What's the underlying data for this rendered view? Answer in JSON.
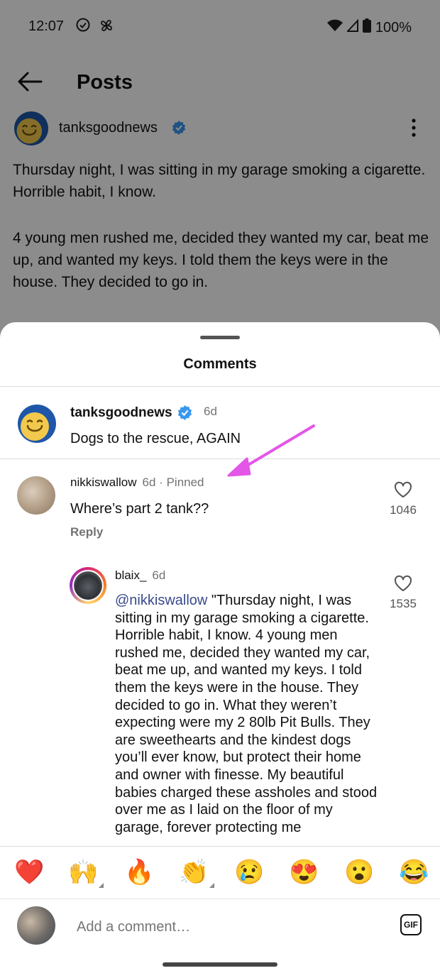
{
  "status_bar": {
    "time": "12:07",
    "battery": "100%"
  },
  "header": {
    "title": "Posts"
  },
  "post": {
    "author": "tanksgoodnews",
    "paragraphs": [
      "Thursday night, I was sitting in my garage smoking a cigarette. Horrible habit, I know.",
      "4 young men rushed me, decided they wanted my car, beat me up, and wanted my keys. I told them the keys were in the house. They decided to go in."
    ]
  },
  "sheet": {
    "title": "Comments"
  },
  "caption": {
    "author": "tanksgoodnews",
    "time": "6d",
    "text": "Dogs to the rescue, AGAIN"
  },
  "comments": [
    {
      "author": "nikkiswallow",
      "time": "6d",
      "pinned": "· Pinned",
      "text": "Where’s part 2 tank??",
      "reply": "Reply",
      "likes": "1046"
    },
    {
      "author": "blaix_",
      "time": "6d",
      "mention": "@nikkiswallow",
      "text": " \"Thursday night, I was sitting in my garage smoking a cigarette. Horrible habit, I know. 4 young men rushed me, decided they wanted my car, beat me up, and wanted my keys. I told them the keys were in the house. They decided to go in. What they weren’t expecting were my 2 80lb Pit Bulls. They are sweethearts and the kindest dogs you’ll ever know, but protect their home and owner with finesse. My beautiful babies charged these assholes and stood over me as I laid on the floor of my garage, forever protecting me",
      "likes": "1535"
    }
  ],
  "reactions": [
    "❤️",
    "🙌",
    "🔥",
    "👏",
    "😢",
    "😍",
    "😮",
    "😂"
  ],
  "comment_input": {
    "placeholder": "Add a comment…",
    "gif_label": "GIF"
  },
  "colors": {
    "accent_arrow": "#e356e8",
    "verified": "#3897f0",
    "mention": "#3a4a8c"
  }
}
